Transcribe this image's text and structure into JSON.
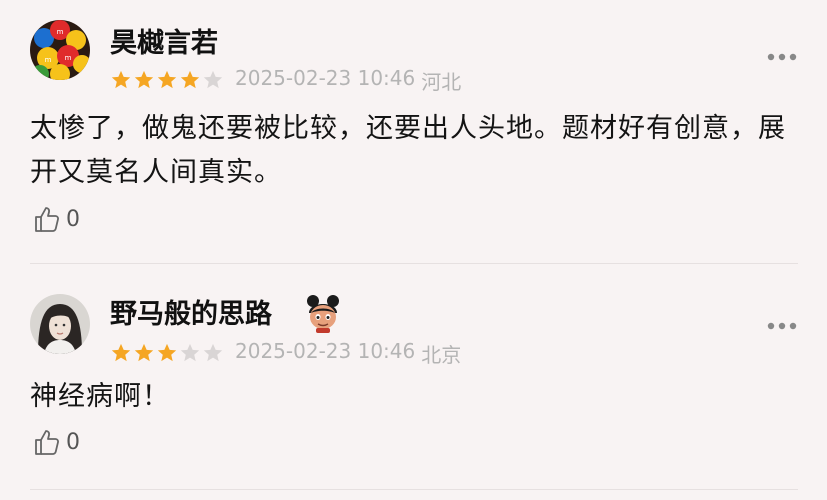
{
  "reviews": [
    {
      "username": "昊樾言若",
      "rating": 4,
      "rating_max": 5,
      "date": "2025-02-23 10:46",
      "location": "河北",
      "text": "太惨了，做鬼还要被比较，还要出人头地。题材好有创意，展开又莫名人间真实。",
      "likes": "0",
      "avatar_icon": "candy-avatar"
    },
    {
      "username": "野马般的思路",
      "rating": 3,
      "rating_max": 5,
      "date": "2025-02-23 10:46",
      "location": "北京",
      "text": "神经病啊！",
      "likes": "0",
      "avatar_icon": "portrait-avatar",
      "badge_icon": "cartoon-character-badge"
    }
  ],
  "colors": {
    "star_filled": "#f5a623",
    "star_empty": "#d9d5d5",
    "meta_text": "#b4b4b4",
    "background": "#f8f3f3"
  }
}
